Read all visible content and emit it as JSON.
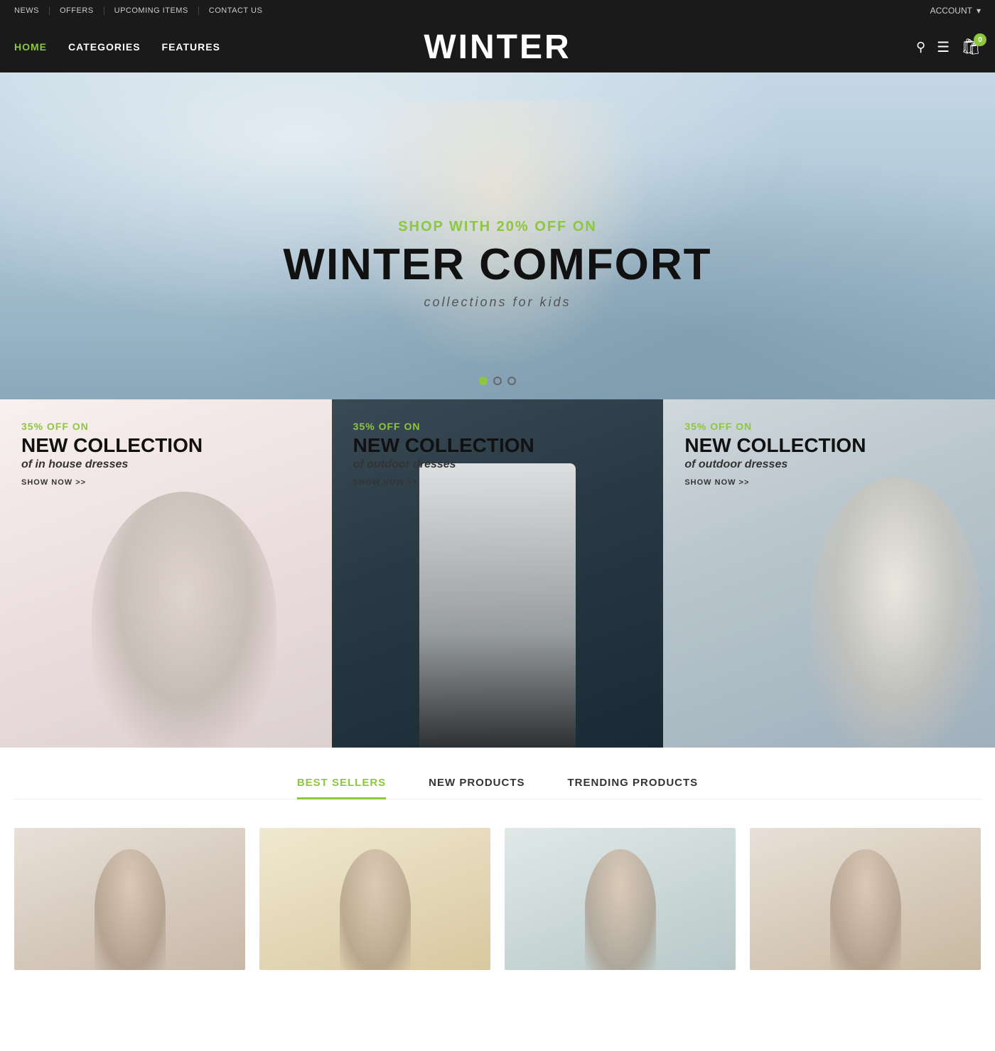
{
  "topbar": {
    "nav_items": [
      {
        "label": "NEWS",
        "id": "news"
      },
      {
        "label": "OFFERS",
        "id": "offers"
      },
      {
        "label": "UPCOMING ITEMS",
        "id": "upcoming"
      },
      {
        "label": "CONTACT US",
        "id": "contact"
      }
    ],
    "account_label": "ACCOUNT"
  },
  "mainnav": {
    "logo": "WINTER",
    "links": [
      {
        "label": "HOME",
        "active": true
      },
      {
        "label": "CATEGORIES",
        "active": false
      },
      {
        "label": "FEATURES",
        "active": false
      }
    ],
    "cart_count": "0"
  },
  "hero": {
    "subtitle": "SHOP WITH 20% OFF ON",
    "title": "WINTER COMFORT",
    "tagline": "collections for kids",
    "dots": [
      {
        "active": true
      },
      {
        "active": false
      },
      {
        "active": false
      }
    ]
  },
  "promo_cards": [
    {
      "percent_text": "35% OFF ON",
      "title": "NEW COLLECTION",
      "subtitle": "of in house dresses",
      "cta": "SHOW NOW >>"
    },
    {
      "percent_text": "35% OFF ON",
      "title": "NEW COLLECTION",
      "subtitle": "of outdoor dresses",
      "cta": "SHOW NOW >>"
    },
    {
      "percent_text": "35% OFF ON",
      "title": "NEW COLLECTION",
      "subtitle": "of outdoor dresses",
      "cta": "SHOW NOW >>"
    }
  ],
  "product_section": {
    "tabs": [
      {
        "label": "BEST SELLERS",
        "active": true
      },
      {
        "label": "NEW PRODUCTS",
        "active": false
      },
      {
        "label": "TRENDING PRODUCTS",
        "active": false
      }
    ]
  }
}
